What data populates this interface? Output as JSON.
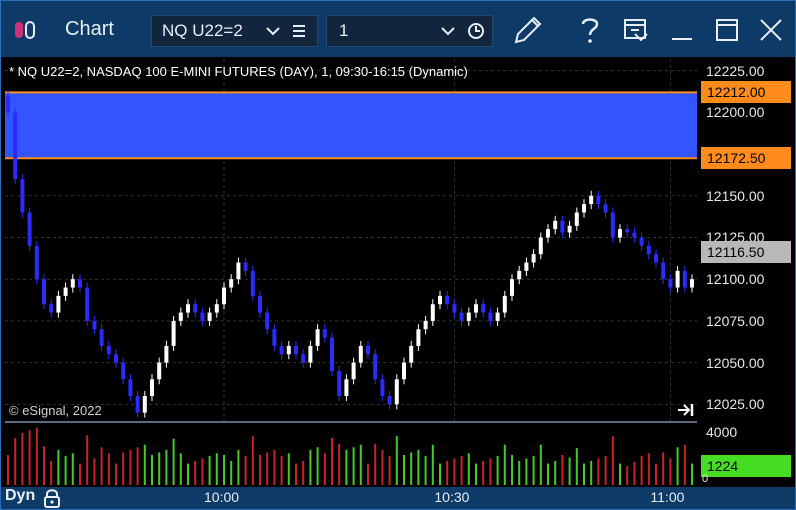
{
  "window": {
    "title": "Chart",
    "symbol": "NQ U22=2",
    "interval": "1"
  },
  "chart_header": "* NQ U22=2, NASDAQ 100 E-MINI FUTURES (DAY), 1, 09:30-16:15 (Dynamic)",
  "copyright": "© eSignal, 2022",
  "mode_label": "Dyn",
  "colors": {
    "titlebar": "#0d3a66",
    "up_candle": "#ffffff",
    "down_candle": "#2b2bff",
    "band_fill": "#3355ff",
    "band_line": "#ff8c1a",
    "price_tag": "#b8b8b8",
    "volume_tag": "#44dd22"
  },
  "chart_data": {
    "type": "candlestick",
    "price_axis": {
      "ticks": [
        12225.0,
        12200.0,
        12150.0,
        12125.0,
        12100.0,
        12075.0,
        12050.0,
        12025.0
      ],
      "tick_labels": [
        "12225.00",
        "12200.00",
        "12150.00",
        "12125.00",
        "12100.00",
        "12075.00",
        "12050.00",
        "12025.00"
      ],
      "range": [
        12015,
        12232
      ]
    },
    "time_axis": {
      "labels": [
        "10:00",
        "10:30",
        "11:00"
      ]
    },
    "band": {
      "upper": 12212.0,
      "lower": 12172.5,
      "upper_label": "12212.00",
      "lower_label": "12172.50"
    },
    "last_price": {
      "value": 12116.5,
      "label": "12116.50"
    },
    "volume_axis": {
      "max_label": "4000",
      "last_label": "1224",
      "zero_label": "0",
      "range": [
        0,
        4200
      ]
    },
    "closes": [
      12200,
      12160,
      12140,
      12120,
      12100,
      12085,
      12080,
      12090,
      12095,
      12100,
      12095,
      12075,
      12070,
      12060,
      12055,
      12050,
      12040,
      12030,
      12020,
      12030,
      12040,
      12050,
      12060,
      12075,
      12080,
      12085,
      12080,
      12075,
      12080,
      12085,
      12095,
      12100,
      12110,
      12105,
      12090,
      12080,
      12070,
      12060,
      12055,
      12060,
      12055,
      12050,
      12060,
      12070,
      12065,
      12045,
      12030,
      12040,
      12050,
      12060,
      12055,
      12040,
      12030,
      12025,
      12040,
      12050,
      12060,
      12070,
      12075,
      12085,
      12090,
      12085,
      12080,
      12075,
      12080,
      12085,
      12080,
      12075,
      12080,
      12090,
      12100,
      12105,
      12110,
      12115,
      12125,
      12130,
      12135,
      12128,
      12132,
      12140,
      12145,
      12150,
      12145,
      12140,
      12125,
      12130,
      12128,
      12125,
      12120,
      12115,
      12110,
      12100,
      12095,
      12105,
      12095,
      12100
    ]
  }
}
